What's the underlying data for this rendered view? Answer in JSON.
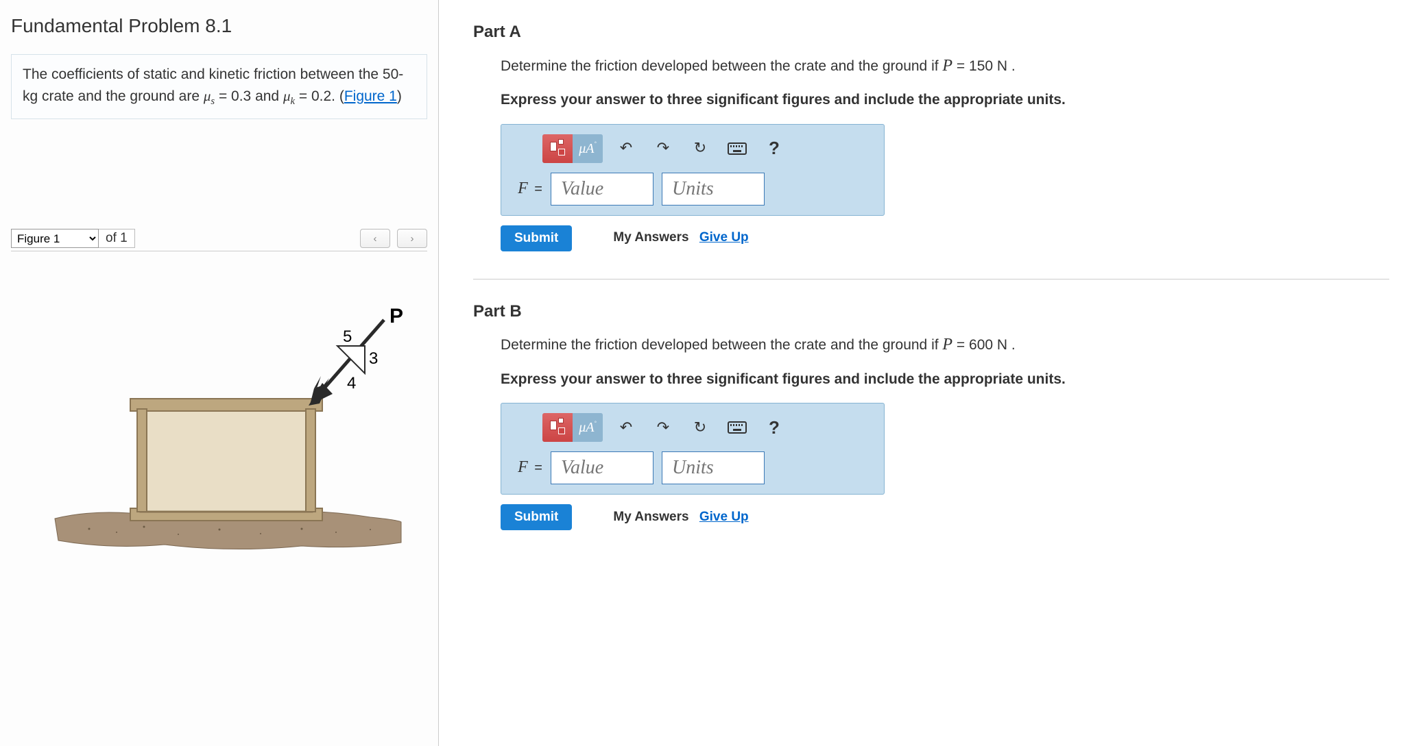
{
  "problem": {
    "title": "Fundamental Problem 8.1",
    "description_pre": "The coefficients of static and kinetic friction between the 50-kg crate and the ground are ",
    "mu_s_sym": "μ",
    "mu_s_sub": "s",
    "mu_s_val": " = 0.3 and ",
    "mu_k_sym": "μ",
    "mu_k_sub": "k",
    "mu_k_val": " = 0.2. (",
    "figure_link": "Figure 1",
    "desc_end": ")"
  },
  "figure": {
    "selected": "Figure 1",
    "count": "of 1",
    "prev": "‹",
    "next": "›",
    "force_label": "P",
    "tri_hyp": "5",
    "tri_opp": "3",
    "tri_adj": "4"
  },
  "toolbar": {
    "units_label": "μÅ",
    "undo": "↶",
    "redo": "↷",
    "reset": "↻",
    "help": "?"
  },
  "parts": [
    {
      "key": "A",
      "heading": "Part A",
      "question_pre": "Determine the friction developed between the crate and the ground if ",
      "P_sym": "P",
      "P_val": " = 150  N .",
      "instruction": "Express your answer to three significant figures and include the appropriate units.",
      "answer_label": "F",
      "eq": " =",
      "value_ph": "Value",
      "units_ph": "Units",
      "submit": "Submit",
      "my_answers": "My Answers",
      "give_up": "Give Up"
    },
    {
      "key": "B",
      "heading": "Part B",
      "question_pre": "Determine the friction developed between the crate and the ground if ",
      "P_sym": "P",
      "P_val": " = 600  N .",
      "instruction": "Express your answer to three significant figures and include the appropriate units.",
      "answer_label": "F",
      "eq": " =",
      "value_ph": "Value",
      "units_ph": "Units",
      "submit": "Submit",
      "my_answers": "My Answers",
      "give_up": "Give Up"
    }
  ]
}
